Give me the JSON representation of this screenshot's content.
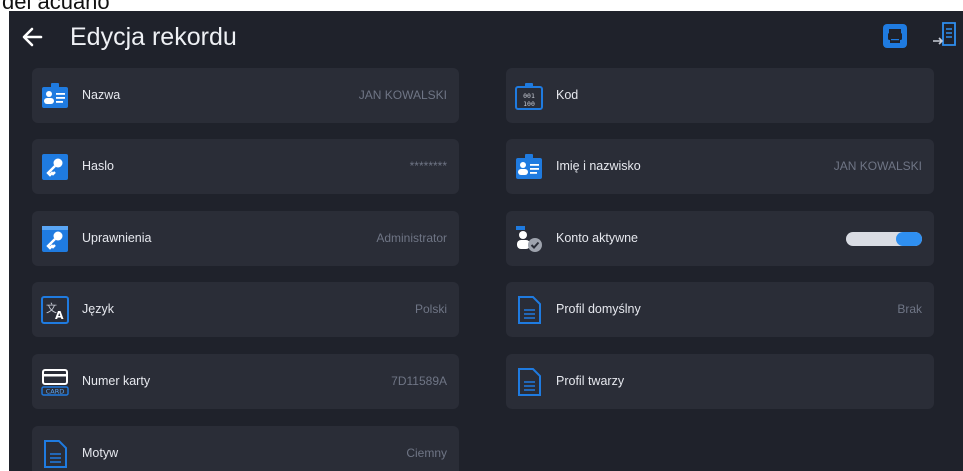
{
  "top_fragment": "dei acuano",
  "header": {
    "title": "Edycja rekordu"
  },
  "colors": {
    "background": "#1f222b",
    "card": "#2a2d37",
    "accent": "#1f7be0",
    "label": "#e6e8ee",
    "value": "#6f7585"
  },
  "fields": [
    {
      "label": "Nazwa",
      "value": "JAN KOWALSKI",
      "icon": "id-card-icon"
    },
    {
      "label": "Kod",
      "value": "",
      "icon": "code-icon"
    },
    {
      "label": "Haslo",
      "value": "********",
      "icon": "key-icon"
    },
    {
      "label": "Imię i nazwisko",
      "value": "JAN KOWALSKI",
      "icon": "id-card-icon"
    },
    {
      "label": "Uprawnienia",
      "value": "Administrator",
      "icon": "key-icon"
    },
    {
      "label": "Konto aktywne",
      "value": "",
      "icon": "user-check-icon",
      "toggle_on": true
    },
    {
      "label": "Język",
      "value": "Polski",
      "icon": "translate-icon"
    },
    {
      "label": "Profil domyślny",
      "value": "Brak",
      "icon": "document-icon"
    },
    {
      "label": "Numer karty",
      "value": "7D11589A",
      "icon": "card-icon",
      "icon_text": "CARD"
    },
    {
      "label": "Profil twarzy",
      "value": "",
      "icon": "document-icon"
    },
    {
      "label": "Motyw",
      "value": "Ciemny",
      "icon": "document-icon"
    }
  ]
}
